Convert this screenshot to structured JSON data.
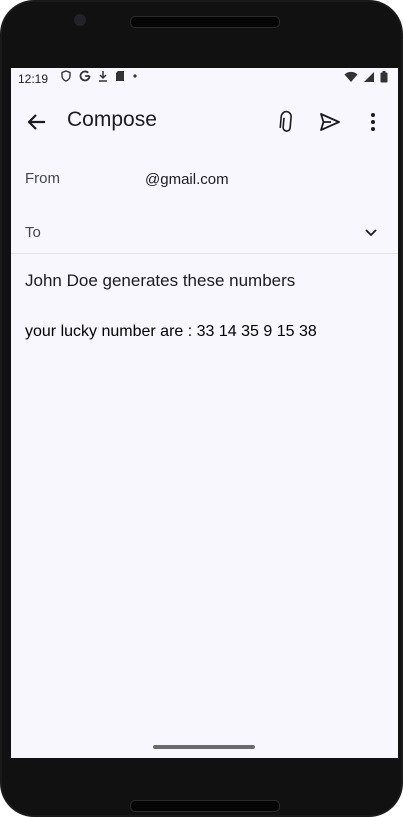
{
  "status_bar": {
    "time": "12:19",
    "left_icons": [
      "shield-icon",
      "google-icon",
      "download-icon",
      "sd-card-icon",
      "dot-icon"
    ],
    "right_icons": [
      "wifi-icon",
      "signal-icon",
      "battery-icon"
    ]
  },
  "app_bar": {
    "title": "Compose",
    "icons": [
      "back-arrow-icon",
      "attach-icon",
      "send-icon",
      "more-vert-icon"
    ]
  },
  "compose": {
    "from_label": "From",
    "from_value": "@gmail.com",
    "to_label": "To",
    "subject": "John Doe generates these numbers",
    "body": "your lucky number are : 33 14 35 9 15 38"
  },
  "colors": {
    "background": "#f8f7fd",
    "text": "#1c1b1f"
  }
}
